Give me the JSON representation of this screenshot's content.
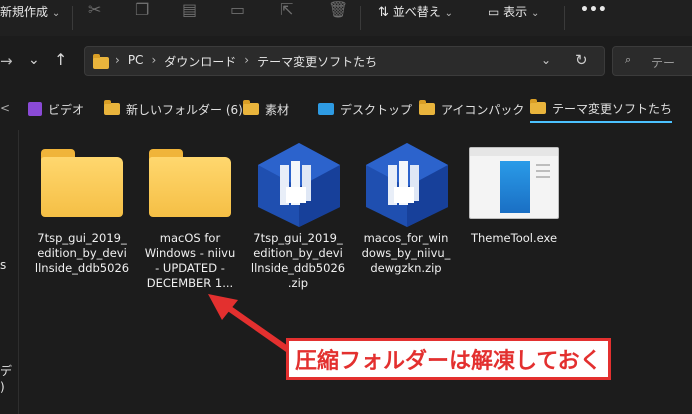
{
  "toolbar": {
    "new_label": "新規作成",
    "sort_label": "並べ替え",
    "view_label": "表示",
    "more_label": "•••"
  },
  "breadcrumb": {
    "segments": [
      "PC",
      "ダウンロード",
      "テーマ変更ソフトたち"
    ]
  },
  "search": {
    "placeholder": "テー"
  },
  "pins": [
    {
      "label": "ビデオ",
      "icon": "video-icon"
    },
    {
      "label": "新しいフォルダー (6)",
      "icon": "folder-icon"
    },
    {
      "label": "素材",
      "icon": "folder-icon"
    },
    {
      "label": "デスクトップ",
      "icon": "desktop-icon"
    },
    {
      "label": "アイコンパック",
      "icon": "folder-icon"
    },
    {
      "label": "テーマ変更ソフトたち",
      "icon": "folder-icon",
      "active": true
    }
  ],
  "left_edge": [
    "s",
    "デ",
    ")"
  ],
  "files": [
    {
      "name": "7tsp_gui_2019_\nedition_by_devi\nllnside_ddb5026",
      "type": "folder"
    },
    {
      "name": "macOS for\nWindows - niivu\n- UPDATED -\nDECEMBER 1...",
      "type": "folder"
    },
    {
      "name": "7tsp_gui_2019_\nedition_by_devi\nllnside_ddb5026\n.zip",
      "type": "zip"
    },
    {
      "name": "macos_for_win\ndows_by_niivu_\ndewgzkn.zip",
      "type": "zip"
    },
    {
      "name": "ThemeTool.exe",
      "type": "exe"
    }
  ],
  "annotation": {
    "text": "圧縮フォルダーは解凍しておく"
  },
  "colors": {
    "accent": "#4cc2ff",
    "annotation_red": "#e3302f",
    "folder_yellow": "#f5bf45",
    "zip_blue": "#1f4fb0"
  }
}
